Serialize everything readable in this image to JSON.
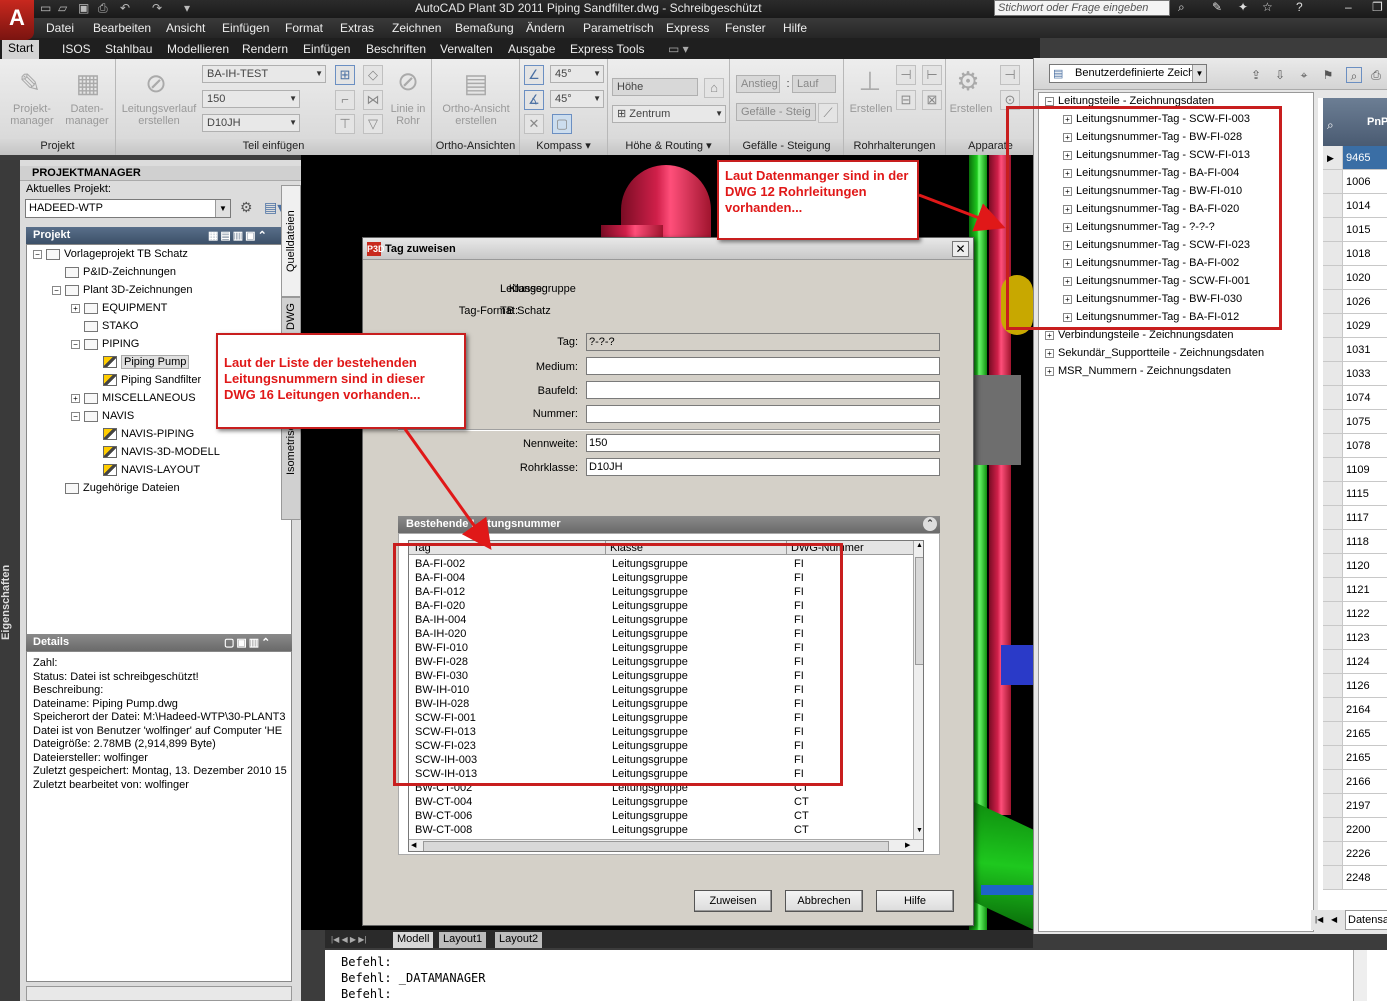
{
  "app": {
    "title": "AutoCAD Plant 3D 2011    Piping Sandfilter.dwg - Schreibgeschützt",
    "search_placeholder": "Stichwort oder Frage eingeben",
    "logo": "A"
  },
  "menu": [
    "Datei",
    "Bearbeiten",
    "Ansicht",
    "Einfügen",
    "Format",
    "Extras",
    "Zeichnen",
    "Bemaßung",
    "Ändern",
    "Parametrisch",
    "Express",
    "Fenster",
    "Hilfe"
  ],
  "ribbon_tabs": [
    "Start",
    "ISOS",
    "Stahlbau",
    "Modellieren",
    "Rendern",
    "Einfügen",
    "Beschriften",
    "Verwalten",
    "Ausgabe",
    "Express Tools"
  ],
  "ribbon": {
    "projekt": {
      "title": "Projekt",
      "btn1": "Projekt-\nmanager",
      "btn2": "Daten-\nmanager"
    },
    "teil": {
      "title": "Teil einfügen",
      "leitungsverlauf": "Leitungsverlauf\nerstellen",
      "combo1": "BA-IH-TEST",
      "combo2": "150",
      "combo3": "D10JH",
      "linie": "Linie in\nRohr"
    },
    "ortho": {
      "title": "Ortho-Ansichten",
      "btn": "Ortho-Ansicht\nerstellen"
    },
    "kompass": {
      "title": "Kompass",
      "angle1": "45°",
      "angle2": "45°"
    },
    "hoehe": {
      "title": "Höhe & Routing",
      "hoehe_field": "Höhe",
      "zentrum": "Zentrum"
    },
    "steigung": {
      "title": "Gefälle - Steigung",
      "anstieg": "Anstieg",
      "sep": ":",
      "lauf": "Lauf",
      "gefaelle": "Gefälle - Steig"
    },
    "rohrhalterungen": {
      "title": "Rohrhalterungen",
      "erstellen": "Erstellen"
    },
    "apparate": {
      "title": "Apparate",
      "erstellen": "Erstellen"
    }
  },
  "project_manager": {
    "title": "PROJEKTMANAGER",
    "current_label": "Aktuelles Projekt:",
    "current_value": "HADEED-WTP",
    "project_header": "Projekt",
    "vtabs": [
      "Quelldateien",
      "DWG",
      "Isometrische DWG"
    ],
    "tree": [
      {
        "label": "Vorlageprojekt TB Schatz",
        "level": 0,
        "exp": "−",
        "icon": "folder"
      },
      {
        "label": "P&ID-Zeichnungen",
        "level": 1,
        "exp": "",
        "icon": "folder"
      },
      {
        "label": "Plant 3D-Zeichnungen",
        "level": 1,
        "exp": "−",
        "icon": "folder"
      },
      {
        "label": "EQUIPMENT",
        "level": 2,
        "exp": "+",
        "icon": "folder"
      },
      {
        "label": "STAKO",
        "level": 2,
        "exp": "",
        "icon": "folder"
      },
      {
        "label": "PIPING",
        "level": 2,
        "exp": "−",
        "icon": "folder"
      },
      {
        "label": "Piping Pump",
        "level": 3,
        "exp": "",
        "icon": "dwg",
        "selected": true
      },
      {
        "label": "Piping Sandfilter",
        "level": 3,
        "exp": "",
        "icon": "dwg"
      },
      {
        "label": "MISCELLANEOUS",
        "level": 2,
        "exp": "+",
        "icon": "folder"
      },
      {
        "label": "NAVIS",
        "level": 2,
        "exp": "−",
        "icon": "folder"
      },
      {
        "label": "NAVIS-PIPING",
        "level": 3,
        "exp": "",
        "icon": "dwg"
      },
      {
        "label": "NAVIS-3D-MODELL",
        "level": 3,
        "exp": "",
        "icon": "dwg"
      },
      {
        "label": "NAVIS-LAYOUT",
        "level": 3,
        "exp": "",
        "icon": "dwg"
      },
      {
        "label": "Zugehörige Dateien",
        "level": 1,
        "exp": "",
        "icon": "folder"
      }
    ],
    "details_header": "Details",
    "details": [
      "Zahl:",
      "Status: Datei ist schreibgeschützt!",
      "Beschreibung:",
      "Dateiname:  Piping Pump.dwg",
      "Speicherort  der  Datei:  M:\\Hadeed-WTP\\30-PLANT3",
      "Datei  ist  von  Benutzer  'wolfinger'  auf  Computer  'HE",
      "Dateigröße: 2.78MB (2,914,899 Byte)",
      "Dateiersteller:  wolfinger",
      "Zuletzt gespeichert: Montag, 13. Dezember 2010 15",
      "Zuletzt bearbeitet von: wolfinger"
    ],
    "properties_tab": "Eigenschaften"
  },
  "dialog": {
    "title": "Tag zuweisen",
    "icon": "P3D",
    "close": "✕",
    "klasse_label": "Klasse:",
    "klasse_value": "Leitungsgruppe",
    "tagformat_label": "Tag-Format:",
    "tagformat_value": "TB Schatz",
    "tag_label": "Tag:",
    "tag_value": "?-?-?",
    "medium_label": "Medium:",
    "baufeld_label": "Baufeld:",
    "nummer_label": "Nummer:",
    "nennweite_label": "Nennweite:",
    "nennweite_value": "150",
    "rohrklasse_label": "Rohrklasse:",
    "rohrklasse_value": "D10JH",
    "group_header": "Bestehende Leitungsnummer",
    "columns": [
      "Tag",
      "Klasse",
      "DWG-Nummer"
    ],
    "rows": [
      [
        "BA-FI-002",
        "Leitungsgruppe",
        "FI"
      ],
      [
        "BA-FI-004",
        "Leitungsgruppe",
        "FI"
      ],
      [
        "BA-FI-012",
        "Leitungsgruppe",
        "FI"
      ],
      [
        "BA-FI-020",
        "Leitungsgruppe",
        "FI"
      ],
      [
        "BA-IH-004",
        "Leitungsgruppe",
        "FI"
      ],
      [
        "BA-IH-020",
        "Leitungsgruppe",
        "FI"
      ],
      [
        "BW-FI-010",
        "Leitungsgruppe",
        "FI"
      ],
      [
        "BW-FI-028",
        "Leitungsgruppe",
        "FI"
      ],
      [
        "BW-FI-030",
        "Leitungsgruppe",
        "FI"
      ],
      [
        "BW-IH-010",
        "Leitungsgruppe",
        "FI"
      ],
      [
        "BW-IH-028",
        "Leitungsgruppe",
        "FI"
      ],
      [
        "SCW-FI-001",
        "Leitungsgruppe",
        "FI"
      ],
      [
        "SCW-FI-013",
        "Leitungsgruppe",
        "FI"
      ],
      [
        "SCW-FI-023",
        "Leitungsgruppe",
        "FI"
      ],
      [
        "SCW-IH-003",
        "Leitungsgruppe",
        "FI"
      ],
      [
        "SCW-IH-013",
        "Leitungsgruppe",
        "FI"
      ],
      [
        "BW-CT-002",
        "Leitungsgruppe",
        "CT"
      ],
      [
        "BW-CT-004",
        "Leitungsgruppe",
        "CT"
      ],
      [
        "BW-CT-006",
        "Leitungsgruppe",
        "CT"
      ],
      [
        "BW-CT-008",
        "Leitungsgruppe",
        "CT"
      ]
    ],
    "buttons": {
      "assign": "Zuweisen",
      "cancel": "Abbrechen",
      "help": "Hilfe"
    }
  },
  "data_manager": {
    "view_combo": "Benutzerdefinierte Zeich",
    "tree_root": "Leitungsteile - Zeichnungsdaten",
    "tree_items": [
      "Leitungsnummer-Tag - SCW-FI-003",
      "Leitungsnummer-Tag - BW-FI-028",
      "Leitungsnummer-Tag - SCW-FI-013",
      "Leitungsnummer-Tag - BA-FI-004",
      "Leitungsnummer-Tag - BW-FI-010",
      "Leitungsnummer-Tag - BA-FI-020",
      "Leitungsnummer-Tag - ?-?-?",
      "Leitungsnummer-Tag - SCW-FI-023",
      "Leitungsnummer-Tag - BA-FI-002",
      "Leitungsnummer-Tag - SCW-FI-001",
      "Leitungsnummer-Tag - BW-FI-030",
      "Leitungsnummer-Tag - BA-FI-012"
    ],
    "tree_others": [
      "Verbindungsteile - Zeichnungsdaten",
      "Sekundär_Supportteile - Zeichnungsdaten",
      "MSR_Nummern - Zeichnungsdaten"
    ],
    "grid_header": "PnP",
    "grid_values": [
      "9465",
      "1006",
      "1014",
      "1015",
      "1018",
      "1020",
      "1026",
      "1029",
      "1031",
      "1033",
      "1074",
      "1075",
      "1078",
      "1109",
      "1115",
      "1117",
      "1118",
      "1120",
      "1121",
      "1122",
      "1123",
      "1124",
      "1126",
      "2164",
      "2165",
      "2165",
      "2166",
      "2197",
      "2200",
      "2226",
      "2248"
    ],
    "bottom_tab": "Datensa"
  },
  "layout_tabs": [
    "Modell",
    "Layout1",
    "Layout2"
  ],
  "command_lines": [
    "Befehl:",
    "Befehl: _DATAMANAGER",
    "Befehl:"
  ],
  "annotations": {
    "datamanager_note": "Laut Datenmanger sind in der DWG 12 Rohrleitungen vorhanden...",
    "list_note": "Laut der Liste der bestehenden Leitungsnummern sind in dieser DWG 16 Leitungen vorhanden..."
  },
  "colors": {
    "annotation_red": "#c81e1e",
    "pipe_red": "#d0204a",
    "pipe_green": "#1ec81e",
    "header_blue": "#4a5b72"
  }
}
